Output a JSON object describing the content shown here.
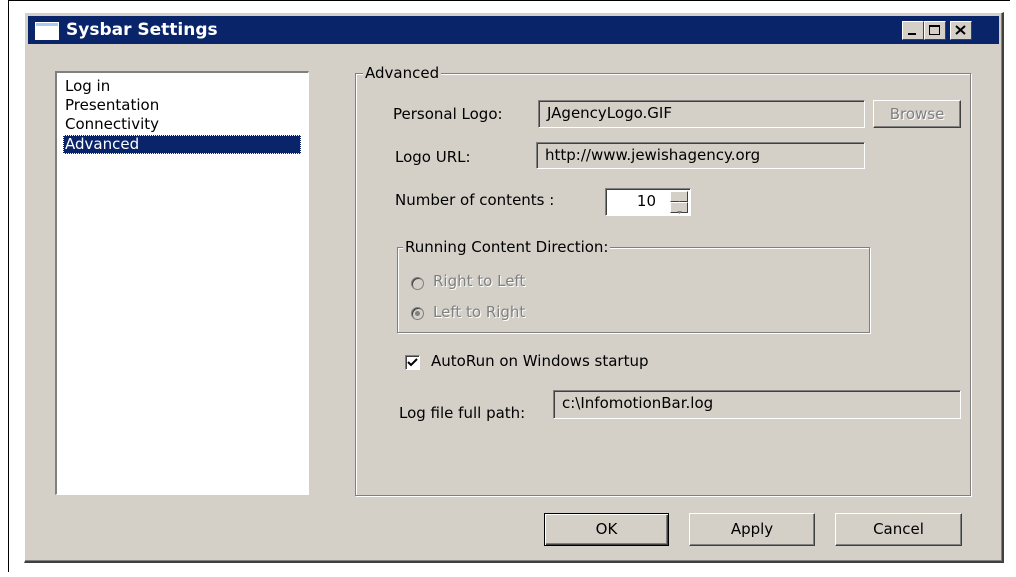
{
  "window": {
    "title": "Sysbar Settings"
  },
  "nav": {
    "items": [
      {
        "label": "Log in"
      },
      {
        "label": "Presentation"
      },
      {
        "label": "Connectivity"
      },
      {
        "label": "Advanced",
        "selected": true
      }
    ]
  },
  "advanced": {
    "group_label": "Advanced",
    "personal_logo_label": "Personal Logo:",
    "personal_logo_value": "JAgencyLogo.GIF",
    "browse_label": "Browse",
    "logo_url_label": "Logo URL:",
    "logo_url_value": "http://www.jewishagency.org",
    "num_contents_label": "Number of contents :",
    "num_contents_value": "10",
    "direction_group_label": "Running Content Direction:",
    "direction_options": [
      {
        "label": "Right  to Left",
        "checked": false
      },
      {
        "label": "Left  to Right",
        "checked": true
      }
    ],
    "autorun_label": "AutoRun on Windows startup",
    "autorun_checked": true,
    "logfile_label": "Log file full path:",
    "logfile_value": "c:\\InfomotionBar.log"
  },
  "footer": {
    "ok_label": "OK",
    "apply_label": "Apply",
    "cancel_label": "Cancel"
  },
  "colors": {
    "titlebar": "#0a246a",
    "face": "#d4d0c8",
    "selection": "#0a246a"
  }
}
